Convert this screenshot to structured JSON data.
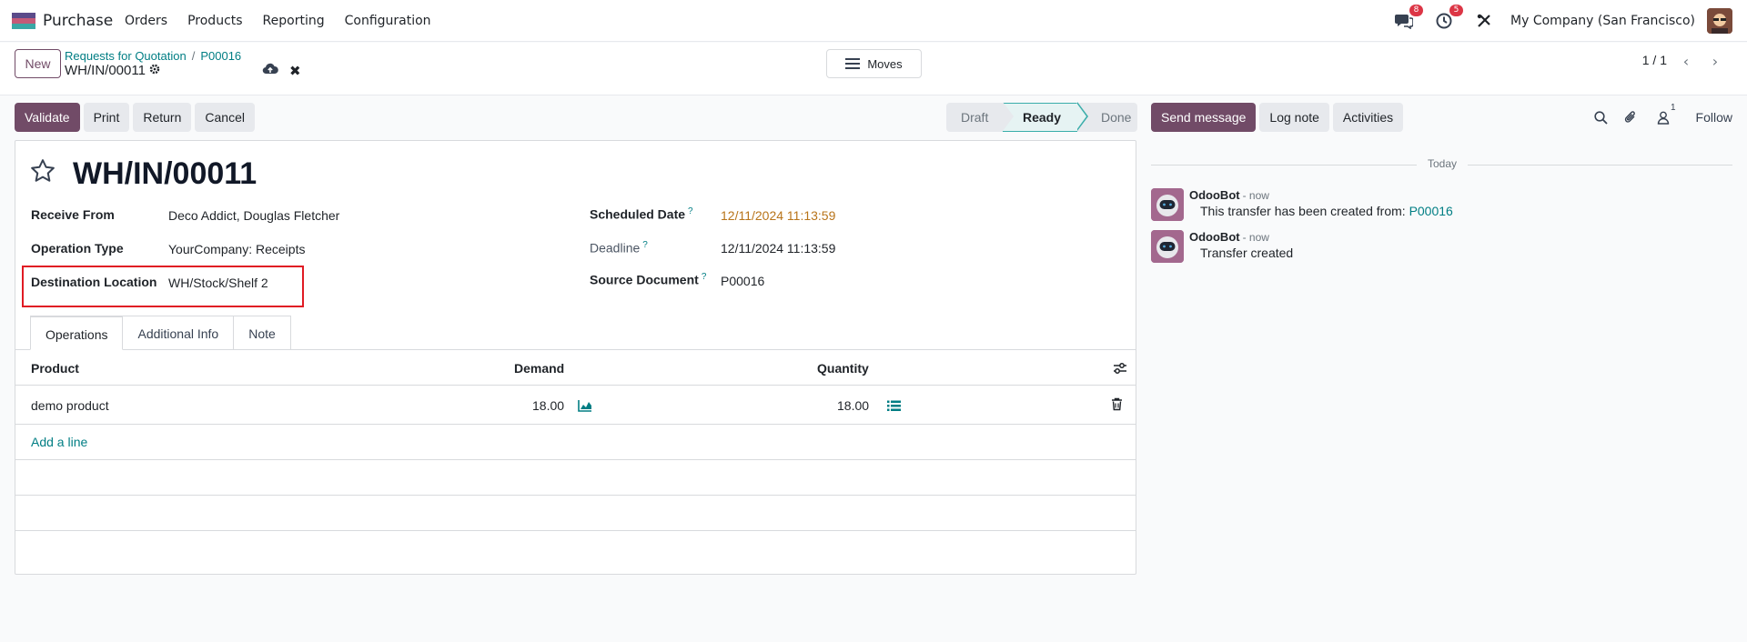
{
  "navbar": {
    "app_name": "Purchase",
    "menu": [
      "Orders",
      "Products",
      "Reporting",
      "Configuration"
    ],
    "messages_badge": "8",
    "activities_badge": "5",
    "company": "My Company (San Francisco)"
  },
  "control": {
    "new_label": "New",
    "breadcrumb_parent": "Requests for Quotation",
    "breadcrumb_sep": "/",
    "breadcrumb_current": "P00016",
    "record_name": "WH/IN/00011",
    "moves_label": "Moves",
    "pager": "1 / 1"
  },
  "actions": {
    "validate": "Validate",
    "print": "Print",
    "return": "Return",
    "cancel": "Cancel"
  },
  "status": {
    "steps": [
      "Draft",
      "Ready",
      "Done"
    ],
    "current": "Ready"
  },
  "form": {
    "title": "WH/IN/00011",
    "receive_from_label": "Receive From",
    "receive_from": "Deco Addict, Douglas Fletcher",
    "operation_type_label": "Operation Type",
    "operation_type": "YourCompany: Receipts",
    "destination_label": "Destination Location",
    "destination": "WH/Stock/Shelf 2",
    "scheduled_date_label": "Scheduled Date",
    "scheduled_date": "12/11/2024 11:13:59",
    "deadline_label": "Deadline",
    "deadline": "12/11/2024 11:13:59",
    "source_document_label": "Source Document",
    "source_document": "P00016",
    "help_mark": "?"
  },
  "tabs": [
    "Operations",
    "Additional Info",
    "Note"
  ],
  "table": {
    "headers": {
      "product": "Product",
      "demand": "Demand",
      "quantity": "Quantity"
    },
    "rows": [
      {
        "product": "demo product",
        "demand": "18.00",
        "quantity": "18.00"
      }
    ],
    "add_line": "Add a line"
  },
  "chatter": {
    "send_message": "Send message",
    "log_note": "Log note",
    "activities": "Activities",
    "followers_count": "1",
    "follow": "Follow",
    "date_separator": "Today",
    "messages": [
      {
        "author": "OdooBot",
        "when": "- now",
        "text": "This transfer has been created from: ",
        "link": "P00016"
      },
      {
        "author": "OdooBot",
        "when": "- now",
        "text": "Transfer created"
      }
    ]
  },
  "colors": {
    "brand": "#714b67",
    "link": "#017e84",
    "ready_step": "#e6f3f3",
    "highlight_box": "#e01b24",
    "badge": "#dc3545"
  }
}
